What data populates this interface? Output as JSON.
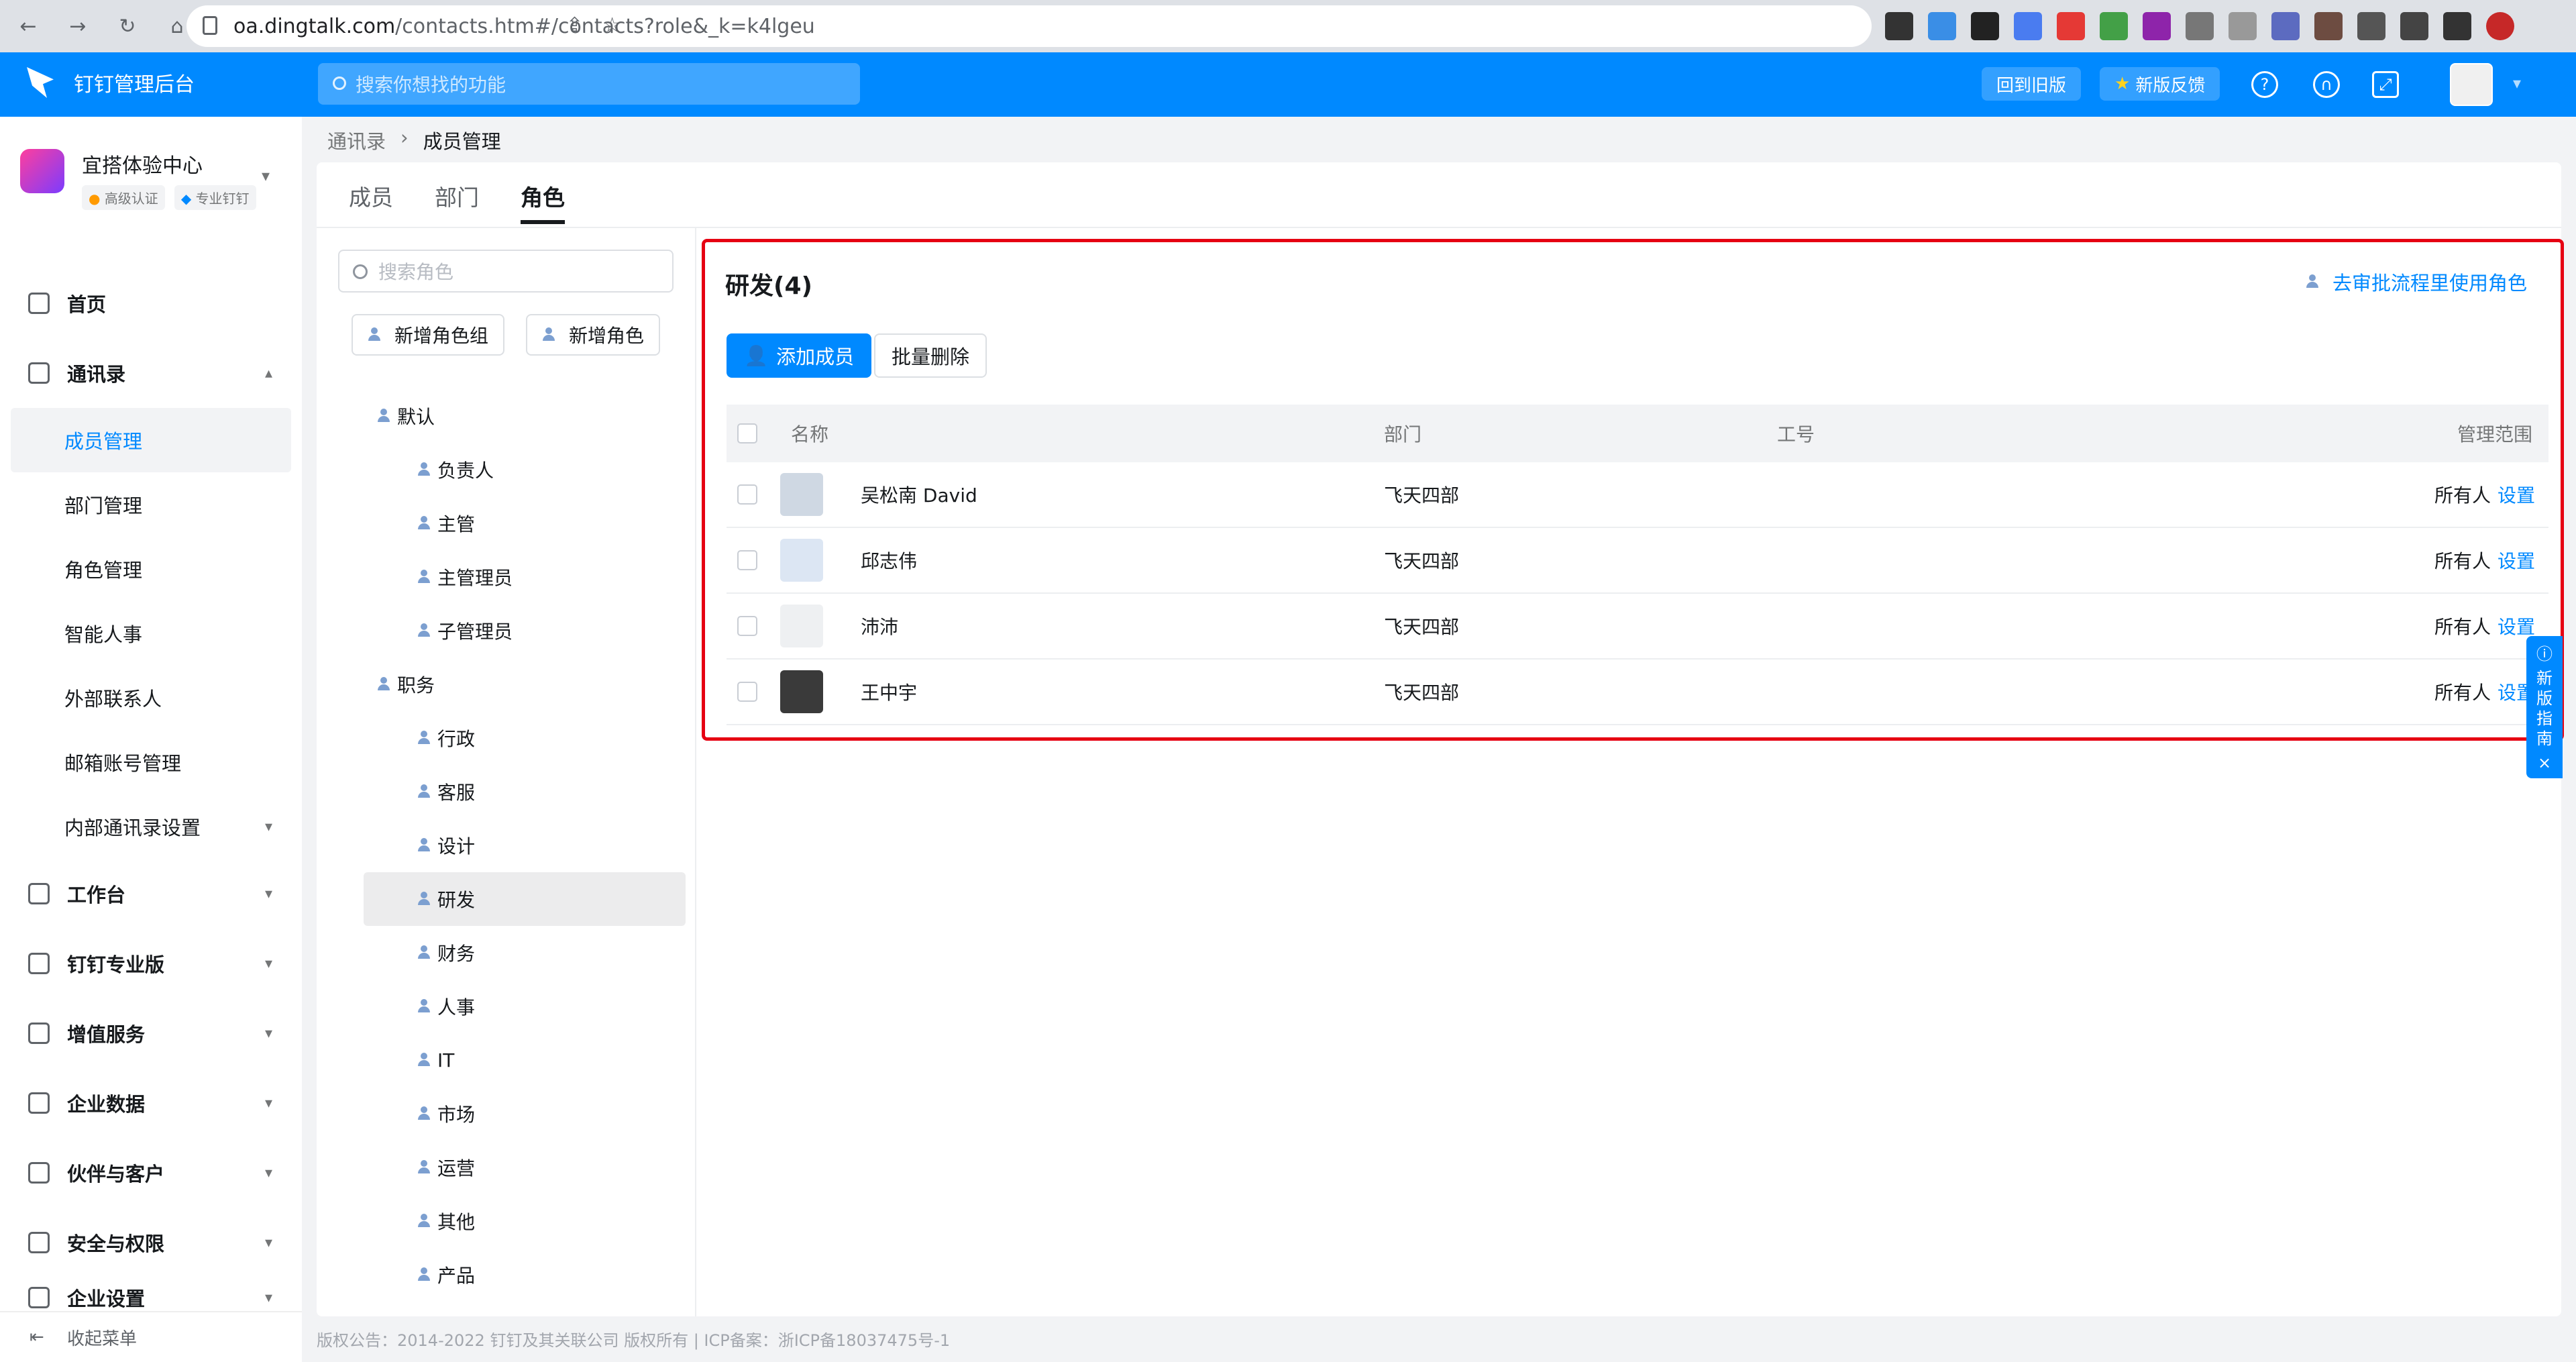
{
  "browser": {
    "url_domain": "oa.dingtalk.com",
    "url_path": "/contacts.htm#/contacts?role&_k=k4lgeu"
  },
  "header": {
    "brand": "钉钉管理后台",
    "search_placeholder": "搜索你想找的功能",
    "old_version_label": "回到旧版",
    "feedback_label": "新版反馈"
  },
  "org": {
    "name": "宜搭体验中心",
    "badge_1": "高级认证",
    "badge_2": "专业钉钉"
  },
  "sidebar": {
    "home": "首页",
    "contacts": "通讯录",
    "contacts_sub": [
      "成员管理",
      "部门管理",
      "角色管理",
      "智能人事",
      "外部联系人",
      "邮箱账号管理",
      "内部通讯录设置"
    ],
    "sections": [
      "工作台",
      "钉钉专业版",
      "增值服务",
      "企业数据",
      "伙伴与客户",
      "安全与权限",
      "企业设置"
    ],
    "collapse": "收起菜单"
  },
  "breadcrumb": {
    "parent": "通讯录",
    "current": "成员管理"
  },
  "tabs": [
    "成员",
    "部门",
    "角色"
  ],
  "roles_panel": {
    "search_placeholder": "搜索角色",
    "add_group": "新增角色组",
    "add_role": "新增角色",
    "group_default": "默认",
    "default_roles": [
      "负责人",
      "主管",
      "主管理员",
      "子管理员"
    ],
    "group_position": "职务",
    "position_roles": [
      "行政",
      "客服",
      "设计",
      "研发",
      "财务",
      "人事",
      "IT",
      "市场",
      "运营",
      "其他",
      "产品"
    ]
  },
  "detail": {
    "title": "研发(4)",
    "approval_link": "去审批流程里使用角色",
    "add_member": "添加成员",
    "batch_delete": "批量删除",
    "columns": {
      "name": "名称",
      "dept": "部门",
      "number": "工号",
      "scope": "管理范围"
    },
    "rows": [
      {
        "name": "吴松南 David",
        "dept": "飞天四部",
        "scope": "所有人",
        "action": "设置"
      },
      {
        "name": "邱志伟",
        "dept": "飞天四部",
        "scope": "所有人",
        "action": "设置"
      },
      {
        "name": "沛沛",
        "dept": "飞天四部",
        "scope": "所有人",
        "action": "设置"
      },
      {
        "name": "王中宇",
        "dept": "飞天四部",
        "scope": "所有人",
        "action": "设置"
      }
    ]
  },
  "guide": "新版指南",
  "footer": "版权公告：2014-2022 钉钉及其关联公司 版权所有 | ICP备案：浙ICP备18037475号-1",
  "colors": {
    "accent": "#0089ff",
    "highlight": "#e60012"
  }
}
